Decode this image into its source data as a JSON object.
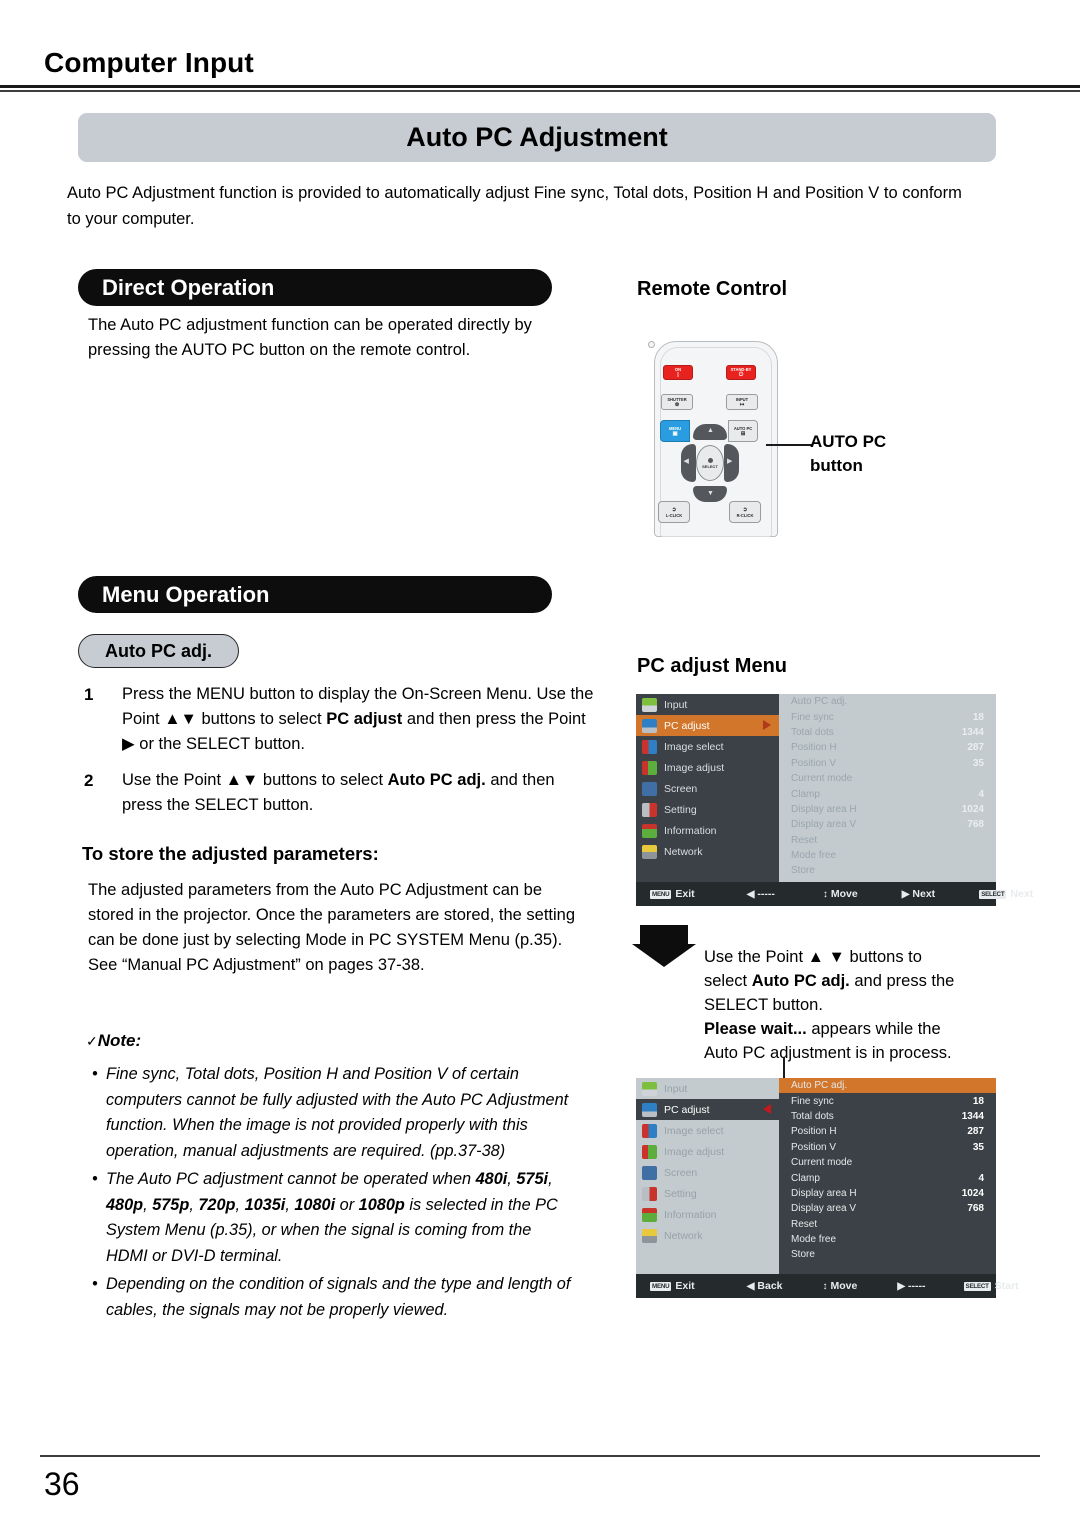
{
  "header": {
    "chapter_title": "Computer Input",
    "page_title": "Auto PC Adjustment",
    "intro": "Auto PC Adjustment function is provided to automatically adjust Fine sync, Total dots, Position H and Position V to conform to your computer."
  },
  "direct_operation": {
    "bar_label": "Direct Operation",
    "body": "The Auto PC adjustment function can be operated directly by pressing the AUTO PC button on the remote control."
  },
  "remote": {
    "heading": "Remote Control",
    "callout_line1": "AUTO PC",
    "callout_line2": "button",
    "buttons": {
      "on": "ON",
      "on_glyph": "|",
      "standby": "STAND-BY",
      "standby_glyph": "⏻",
      "shutter": "SHUTTER",
      "shutter_glyph": "⊗",
      "input": "INPUT",
      "input_glyph": "↦",
      "menu": "MENU",
      "menu_glyph": "▣",
      "autopc": "AUTO PC",
      "autopc_glyph": "⊞",
      "select": "SELECT",
      "lclick": "L-CLICK",
      "rclick": "R-CLICK",
      "up_glyph": "▲",
      "down_glyph": "▼",
      "left_glyph": "◀",
      "right_glyph": "▶"
    }
  },
  "menu_operation": {
    "bar_label": "Menu Operation",
    "pill_label": "Auto PC adj.",
    "steps": [
      {
        "num": "1",
        "text_html": "Press the MENU button to display the On-Screen Menu. Use the Point ▲▼ buttons to select <b>PC adjust</b> and then press the Point ▶ or the SELECT button."
      },
      {
        "num": "2",
        "text_html": "Use the Point ▲▼ buttons to select <b>Auto PC adj.</b> and then press the SELECT button."
      }
    ],
    "store_heading": "To store the adjusted parameters:",
    "store_body": "The adjusted parameters from the Auto PC Adjustment can be stored in the projector. Once the parameters are stored, the setting can be done just by selecting Mode in PC SYSTEM Menu (p.35). See “Manual PC Adjustment” on pages 37-38."
  },
  "note": {
    "check_glyph": "✓",
    "label": "Note:",
    "bullet_glyph": "•",
    "items_html": [
      "Fine sync, Total dots, Position H and Position V  of certain computers cannot be fully adjusted with the Auto PC Adjustment function. When the image is not provided properly with this operation, manual adjustments are required. (pp.37-38)",
      "The Auto PC adjustment cannot be operated when <b>480i</b>, <b>575i</b>, <b>480p</b>, <b>575p</b>, <b>720p</b>, <b>1035i</b>, <b>1080i</b> or <b>1080p</b> is selected in the PC System Menu (p.35), or when the signal is coming from the HDMI or DVI-D terminal.",
      "Depending on the condition of signals and the type and length of cables, the signals may not be properly viewed."
    ]
  },
  "pc_adjust_menu": {
    "heading": "PC adjust Menu",
    "sidebar": [
      {
        "label": "Input",
        "icon": "input-icon"
      },
      {
        "label": "PC adjust",
        "icon": "pc-adjust-icon"
      },
      {
        "label": "Image select",
        "icon": "image-select-icon"
      },
      {
        "label": "Image adjust",
        "icon": "image-adjust-icon"
      },
      {
        "label": "Screen",
        "icon": "screen-icon"
      },
      {
        "label": "Setting",
        "icon": "setting-icon"
      },
      {
        "label": "Information",
        "icon": "information-icon"
      },
      {
        "label": "Network",
        "icon": "network-icon"
      }
    ],
    "selected_sidebar": "PC adjust",
    "rows": [
      {
        "label": "Auto PC adj.",
        "value": ""
      },
      {
        "label": "Fine sync",
        "value": "18"
      },
      {
        "label": "Total dots",
        "value": "1344"
      },
      {
        "label": "Position H",
        "value": "287"
      },
      {
        "label": "Position V",
        "value": "35"
      },
      {
        "label": "Current mode",
        "value": ""
      },
      {
        "label": "Clamp",
        "value": "4"
      },
      {
        "label": "Display area H",
        "value": "1024"
      },
      {
        "label": "Display area V",
        "value": "768"
      },
      {
        "label": "Reset",
        "value": ""
      },
      {
        "label": "Mode free",
        "value": ""
      },
      {
        "label": "Store",
        "value": ""
      }
    ],
    "footer_1": [
      {
        "key": "MENU",
        "glyph": "",
        "label": "Exit"
      },
      {
        "key": "",
        "glyph": "◀",
        "label": "-----"
      },
      {
        "key": "",
        "glyph": "↕",
        "label": "Move"
      },
      {
        "key": "",
        "glyph": "▶",
        "label": "Next"
      },
      {
        "key": "SELECT",
        "glyph": "",
        "label": "Next"
      }
    ],
    "footer_2": [
      {
        "key": "MENU",
        "glyph": "",
        "label": "Exit"
      },
      {
        "key": "",
        "glyph": "◀",
        "label": "Back"
      },
      {
        "key": "",
        "glyph": "↕",
        "label": "Move"
      },
      {
        "key": "",
        "glyph": "▶",
        "label": "-----"
      },
      {
        "key": "SELECT",
        "glyph": "",
        "label": "Start"
      }
    ],
    "highlighted_row": "Auto PC adj."
  },
  "process_note": {
    "line1_html": "Use the Point ▲ ▼ buttons to",
    "line2_html": "select <b>Auto PC adj.</b> and press the",
    "line3_html": "SELECT button.",
    "line4_html": "<b>Please wait...</b> appears while the",
    "line5_html": "Auto PC adjustment is in process."
  },
  "footer": {
    "page_number": "36"
  },
  "colors": {
    "title_bar": "#c6ccd2",
    "section_bar": "#0d0d0d",
    "osd_highlight": "#d1762a",
    "osd_dark": "#3b4146",
    "osd_light": "#c3cbcf",
    "remote_red": "#e8231f",
    "remote_blue": "#2a9de0"
  }
}
